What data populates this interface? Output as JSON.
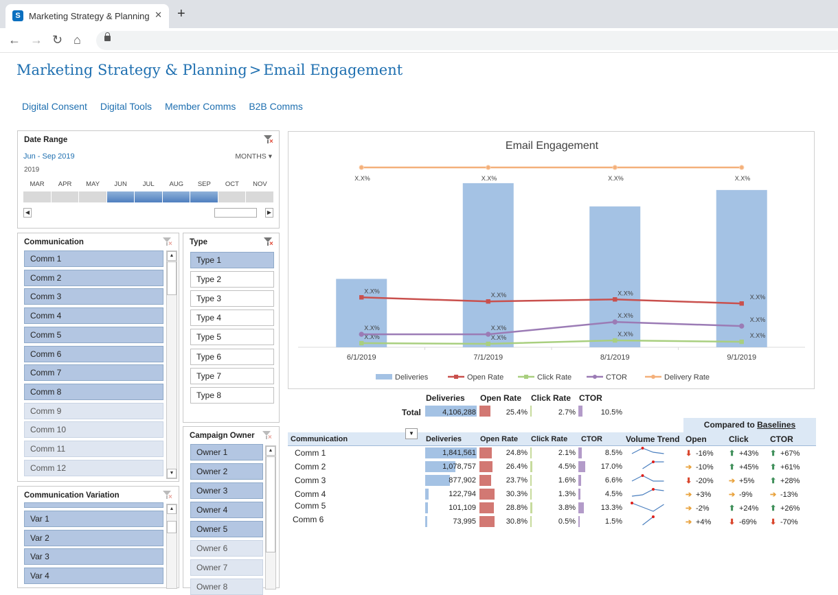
{
  "browser": {
    "tab_title": "Marketing Strategy & Planning -",
    "tab_close": "✕",
    "new_tab": "+",
    "back": "←",
    "forward": "→",
    "reload": "↻",
    "home": "⌂"
  },
  "page": {
    "breadcrumb": [
      "Marketing Strategy & Planning",
      ">",
      "Email Engagement"
    ],
    "nav_links": [
      "Digital Consent",
      "Digital Tools",
      "Member Comms",
      "B2B Comms"
    ]
  },
  "date_range": {
    "title": "Date Range",
    "value": "Jun - Sep 2019",
    "granularity": "MONTHS ▾",
    "year": "2019",
    "months": [
      "MAR",
      "APR",
      "MAY",
      "JUN",
      "JUL",
      "AUG",
      "SEP",
      "OCT",
      "NOV"
    ],
    "selected": [
      false,
      false,
      false,
      true,
      true,
      true,
      true,
      false,
      false
    ]
  },
  "communication": {
    "title": "Communication",
    "items": [
      {
        "label": "Comm 1",
        "selected": true
      },
      {
        "label": "Comm 2",
        "selected": true
      },
      {
        "label": "Comm 3",
        "selected": true
      },
      {
        "label": "Comm 4",
        "selected": true
      },
      {
        "label": "Comm 5",
        "selected": true
      },
      {
        "label": "Comm 6",
        "selected": true
      },
      {
        "label": "Comm 7",
        "selected": true
      },
      {
        "label": "Comm 8",
        "selected": true
      },
      {
        "label": "Comm 9",
        "selected": false
      },
      {
        "label": "Comm 10",
        "selected": false
      },
      {
        "label": "Comm 11",
        "selected": false
      },
      {
        "label": "Comm 12",
        "selected": false
      }
    ]
  },
  "type": {
    "title": "Type",
    "items": [
      {
        "label": "Type 1",
        "selected": true
      },
      {
        "label": "Type 2",
        "selected": false
      },
      {
        "label": "Type 3",
        "selected": false
      },
      {
        "label": "Type 4",
        "selected": false
      },
      {
        "label": "Type 5",
        "selected": false
      },
      {
        "label": "Type 6",
        "selected": false
      },
      {
        "label": "Type 7",
        "selected": false
      },
      {
        "label": "Type 8",
        "selected": false
      }
    ]
  },
  "campaign_owner": {
    "title": "Campaign Owner",
    "items": [
      {
        "label": "Owner 1",
        "selected": true
      },
      {
        "label": "Owner 2",
        "selected": true
      },
      {
        "label": "Owner 3",
        "selected": true
      },
      {
        "label": "Owner 4",
        "selected": true
      },
      {
        "label": "Owner 5",
        "selected": true
      },
      {
        "label": "Owner 6",
        "selected": false
      },
      {
        "label": "Owner 7",
        "selected": false
      },
      {
        "label": "Owner 8",
        "selected": false
      }
    ]
  },
  "communication_variation": {
    "title": "Communication Variation",
    "items": [
      {
        "label": "Var 1",
        "selected": true
      },
      {
        "label": "Var 2",
        "selected": true
      },
      {
        "label": "Var 3",
        "selected": true
      },
      {
        "label": "Var 4",
        "selected": true
      }
    ]
  },
  "chart_data": {
    "type": "bar",
    "title": "Email Engagement",
    "categories": [
      "6/1/2019",
      "7/1/2019",
      "8/1/2019",
      "9/1/2019"
    ],
    "series": [
      {
        "name": "Deliveries",
        "kind": "bar",
        "color": "#a4c2e4",
        "values": [
          100,
          240,
          206,
          230
        ]
      },
      {
        "name": "Open Rate",
        "kind": "line",
        "color": "#c9504d",
        "values": [
          73,
          67,
          70,
          64
        ]
      },
      {
        "name": "Click Rate",
        "kind": "line",
        "color": "#a9cf7f",
        "values": [
          6,
          5,
          10,
          8
        ]
      },
      {
        "name": "CTOR",
        "kind": "line",
        "color": "#9b7bb5",
        "values": [
          19,
          19,
          37,
          31
        ]
      },
      {
        "name": "Delivery Rate",
        "kind": "line",
        "color": "#f4b07a",
        "values": [
          263,
          263,
          263,
          263
        ]
      }
    ],
    "data_labels": "X.X%",
    "ylim": [
      0,
      270
    ],
    "legend": "bottom"
  },
  "totals": {
    "headers": [
      "Deliveries",
      "Open Rate",
      "Click Rate",
      "CTOR"
    ],
    "label": "Total",
    "deliveries": "4,106,288",
    "open_rate": "25.4%",
    "click_rate": "2.7%",
    "ctor": "10.5%"
  },
  "table": {
    "baseline_prefix": "Compared to ",
    "baseline_link": "Baselines",
    "headers": {
      "communication": "Communication",
      "deliveries": "Deliveries",
      "open_rate": "Open Rate",
      "click_rate": "Click Rate",
      "ctor": "CTOR",
      "trend": "Volume Trend",
      "open": "Open",
      "click": "Click",
      "ctor2": "CTOR"
    },
    "rows": [
      {
        "label": "Comm 1",
        "deliveries": "1,841,561",
        "open_rate": "24.8%",
        "click_rate": "2.1%",
        "ctor": "8.5%",
        "trend": [
          3,
          7,
          4,
          3
        ],
        "open": {
          "dir": "down",
          "text": "-16%"
        },
        "click": {
          "dir": "up",
          "text": "+43%"
        },
        "ctor_cmp": {
          "dir": "up",
          "text": "+67%"
        }
      },
      {
        "label": "Comm 2",
        "deliveries": "1,078,757",
        "open_rate": "26.4%",
        "click_rate": "4.5%",
        "ctor": "17.0%",
        "trend": [
          null,
          2,
          7,
          7
        ],
        "open": {
          "dir": "side",
          "text": "-10%"
        },
        "click": {
          "dir": "up",
          "text": "+45%"
        },
        "ctor_cmp": {
          "dir": "up",
          "text": "+61%"
        }
      },
      {
        "label": "Comm 3",
        "deliveries": "877,902",
        "open_rate": "23.7%",
        "click_rate": "1.6%",
        "ctor": "6.6%",
        "trend": [
          3,
          7,
          3,
          3
        ],
        "open": {
          "dir": "down",
          "text": "-20%"
        },
        "click": {
          "dir": "side",
          "text": "+5%"
        },
        "ctor_cmp": {
          "dir": "up",
          "text": "+28%"
        }
      },
      {
        "label": "Comm 4",
        "deliveries": "122,794",
        "open_rate": "30.3%",
        "click_rate": "1.3%",
        "ctor": "4.5%",
        "trend": [
          2,
          3,
          7,
          6
        ],
        "open": {
          "dir": "side",
          "text": "+3%"
        },
        "click": {
          "dir": "side",
          "text": "-9%"
        },
        "ctor_cmp": {
          "dir": "side",
          "text": "-13%"
        }
      },
      {
        "label": "Comm 5",
        "deliveries": "101,109",
        "open_rate": "28.8%",
        "click_rate": "3.8%",
        "ctor": "13.3%",
        "trend": [
          7,
          4,
          1,
          6
        ],
        "open": {
          "dir": "side",
          "text": "-2%"
        },
        "click": {
          "dir": "up",
          "text": "+24%"
        },
        "ctor_cmp": {
          "dir": "up",
          "text": "+26%"
        }
      },
      {
        "label": "Comm 6",
        "deliveries": "73,995",
        "open_rate": "30.8%",
        "click_rate": "0.5%",
        "ctor": "1.5%",
        "trend": [
          null,
          1,
          7,
          null
        ],
        "open": {
          "dir": "side",
          "text": "+4%"
        },
        "click": {
          "dir": "down",
          "text": "-69%"
        },
        "ctor_cmp": {
          "dir": "down",
          "text": "-70%"
        }
      }
    ],
    "bar_fracs": {
      "deliveries": [
        1.0,
        0.586,
        0.477,
        0.067,
        0.055,
        0.04
      ],
      "open_rate": [
        0.8,
        0.86,
        0.77,
        0.98,
        0.94,
        1.0
      ],
      "click_rate": [
        0.47,
        1.0,
        0.36,
        0.29,
        0.84,
        0.11
      ],
      "ctor": [
        0.5,
        1.0,
        0.39,
        0.26,
        0.78,
        0.09
      ]
    },
    "total_fracs": {
      "deliveries": 1.0,
      "open_rate": 0.82,
      "click_rate": 0.6,
      "ctor": 0.62
    }
  },
  "colors": {
    "accent": "#1e6fb0",
    "deliveries_bar": "#a4c2e4",
    "open_bar": "#d27873",
    "click_bar": "#c7db9d",
    "ctor_bar": "#b39bc9"
  }
}
